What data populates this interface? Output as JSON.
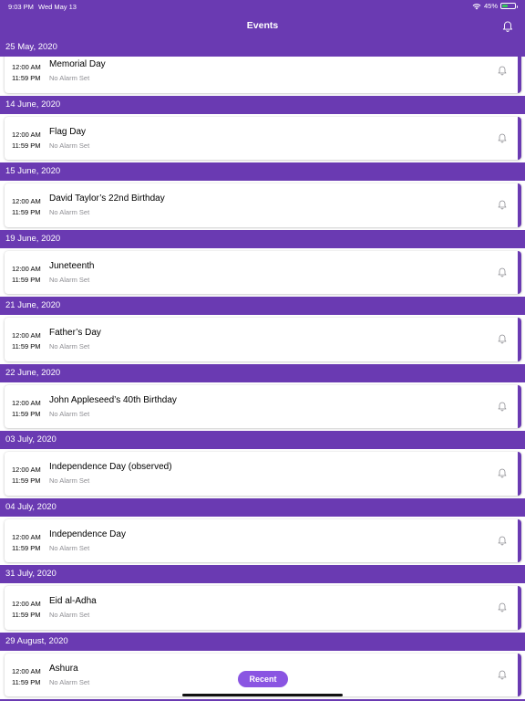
{
  "status": {
    "time": "9:03 PM",
    "date": "Wed May 13",
    "battery": "45%",
    "battery_level": 0.45
  },
  "nav": {
    "title": "Events"
  },
  "sections": [
    {
      "date": "25 May, 2020",
      "event": {
        "start": "12:00 AM",
        "end": "11:59 PM",
        "title": "Memorial Day",
        "alarm": "No Alarm Set"
      }
    },
    {
      "date": "14 June, 2020",
      "event": {
        "start": "12:00 AM",
        "end": "11:59 PM",
        "title": "Flag Day",
        "alarm": "No Alarm Set"
      }
    },
    {
      "date": "15 June, 2020",
      "event": {
        "start": "12:00 AM",
        "end": "11:59 PM",
        "title": "David Taylor’s 22nd Birthday",
        "alarm": "No Alarm Set"
      }
    },
    {
      "date": "19 June, 2020",
      "event": {
        "start": "12:00 AM",
        "end": "11:59 PM",
        "title": "Juneteenth",
        "alarm": "No Alarm Set"
      }
    },
    {
      "date": "21 June, 2020",
      "event": {
        "start": "12:00 AM",
        "end": "11:59 PM",
        "title": "Father’s Day",
        "alarm": "No Alarm Set"
      }
    },
    {
      "date": "22 June, 2020",
      "event": {
        "start": "12:00 AM",
        "end": "11:59 PM",
        "title": "John Appleseed’s 40th Birthday",
        "alarm": "No Alarm Set"
      }
    },
    {
      "date": "03 July, 2020",
      "event": {
        "start": "12:00 AM",
        "end": "11:59 PM",
        "title": "Independence Day (observed)",
        "alarm": "No Alarm Set"
      }
    },
    {
      "date": "04 July, 2020",
      "event": {
        "start": "12:00 AM",
        "end": "11:59 PM",
        "title": "Independence Day",
        "alarm": "No Alarm Set"
      }
    },
    {
      "date": "31 July, 2020",
      "event": {
        "start": "12:00 AM",
        "end": "11:59 PM",
        "title": "Eid al-Adha",
        "alarm": "No Alarm Set"
      }
    },
    {
      "date": "29 August, 2020",
      "event": {
        "start": "12:00 AM",
        "end": "11:59 PM",
        "title": "Ashura",
        "alarm": "No Alarm Set"
      }
    }
  ],
  "recent_label": "Recent",
  "colors": {
    "accent": "#6a3ab2",
    "button": "#8a55e2"
  }
}
